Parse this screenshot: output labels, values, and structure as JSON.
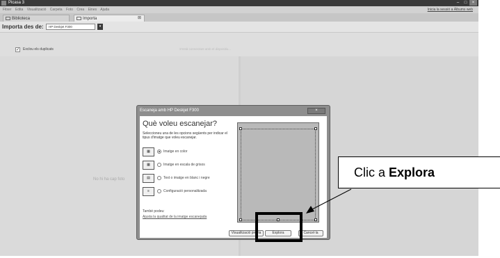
{
  "window": {
    "title": "Picasa 3",
    "controls": [
      "–",
      "□",
      "×"
    ]
  },
  "menu": {
    "items": [
      "Fitxer",
      "Edita",
      "Visualització",
      "Carpeta",
      "Foto",
      "Crea",
      "Eines",
      "Ajuda"
    ],
    "signin_link": "Inicia la sessió a Àlbums web"
  },
  "tabs": [
    {
      "label": "Biblioteca",
      "icon": "library-icon"
    },
    {
      "label": "Importa",
      "icon": "import-icon"
    }
  ],
  "tab_close": "⊠",
  "import_bar": {
    "label": "Importa des de:",
    "device_value": "HP Deskjet F300",
    "device_button": "▾"
  },
  "options": {
    "exclude_duplicates_label": "Exclou els duplicats",
    "exclude_duplicates_checked": true,
    "status_text": "S'està connectant amb el dispositiu..."
  },
  "left_panel": {
    "empty_message": "No hi ha cap foto"
  },
  "dialog": {
    "title": "Escaneja amb HP Deskjet F300",
    "close_label": "×",
    "heading": "Què voleu escanejar?",
    "description": "Seleccioneu una de les opcions següents per indicar el tipus d'imatge que voleu escanejar.",
    "options": [
      {
        "label": "Imatge en color",
        "selected": true,
        "icon": "color-image-icon"
      },
      {
        "label": "Imatge en escala de grisos",
        "selected": false,
        "icon": "grayscale-image-icon"
      },
      {
        "label": "Text o imatge en blanc i negre",
        "selected": false,
        "icon": "bw-text-icon"
      },
      {
        "label": "Configuració personalitzada",
        "selected": false,
        "icon": "custom-settings-icon"
      }
    ],
    "also_label": "També podeu:",
    "quality_link": "Ajusta la qualitat de la imatge escanejada",
    "buttons": {
      "preview": "Visualització prèvia",
      "scan": "Explora",
      "cancel": "Cancel·la"
    }
  },
  "callout": {
    "prefix": "Clic a ",
    "emphasis": "Explora"
  },
  "colors": {
    "highlight_border": "#000000",
    "app_background": "#dedede",
    "title_bar": "#3a3a3a"
  }
}
